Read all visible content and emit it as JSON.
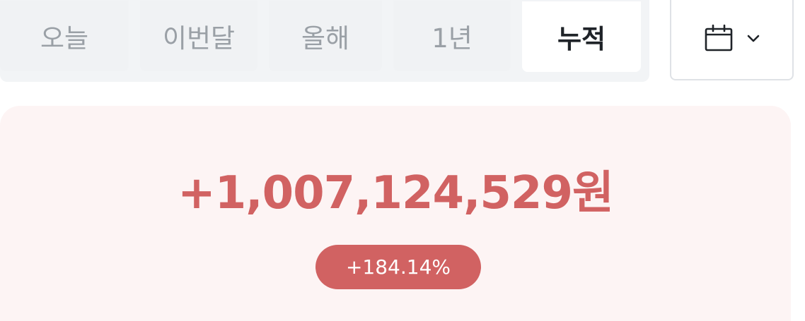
{
  "period_tabs": {
    "items": [
      {
        "label": "오늘",
        "selected": false
      },
      {
        "label": "이번달",
        "selected": false
      },
      {
        "label": "올해",
        "selected": false
      },
      {
        "label": "1년",
        "selected": false
      },
      {
        "label": "누적",
        "selected": true
      }
    ]
  },
  "date_picker": {
    "icon": "calendar-icon",
    "dropdown_icon": "chevron-down-icon"
  },
  "summary": {
    "profit_amount": "+1,007,124,529원",
    "profit_rate": "+184.14%"
  },
  "colors": {
    "accent_red": "#d16262",
    "card_background": "#fdf4f4",
    "tab_background": "#f2f4f6"
  }
}
